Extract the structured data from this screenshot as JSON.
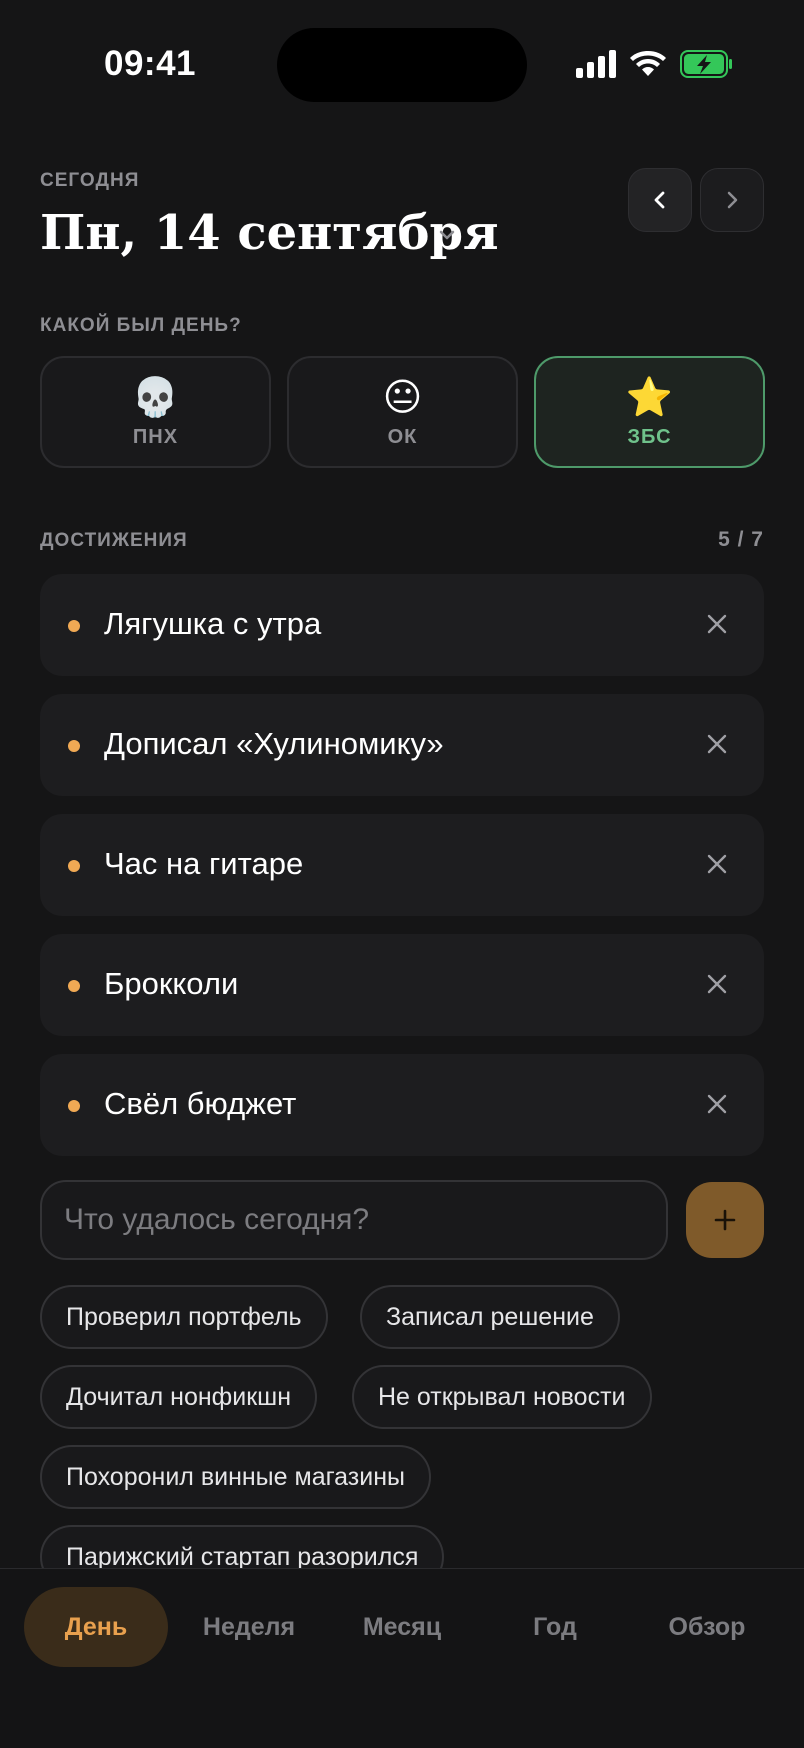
{
  "status_bar": {
    "time": "09:41"
  },
  "header": {
    "today_label": "СЕГОДНЯ",
    "date": "Пн, 14 сентября"
  },
  "mood": {
    "label": "КАКОЙ БЫЛ ДЕНЬ?",
    "options": [
      {
        "emoji": "💀",
        "label": "ПНХ",
        "selected": false
      },
      {
        "emoji": "😐",
        "label": "ОК",
        "selected": false
      },
      {
        "emoji": "⭐",
        "label": "ЗБС",
        "selected": true
      }
    ]
  },
  "achievements": {
    "label": "ДОСТИЖЕНИЯ",
    "count": "5 / 7",
    "items": [
      "Лягушка с утра",
      "Дописал «Хулиномику»",
      "Час на гитаре",
      "Брокколи",
      "Свёл бюджет"
    ]
  },
  "add": {
    "placeholder": "Что удалось сегодня?"
  },
  "suggestions": [
    "Проверил портфель",
    "Записал решение",
    "Дочитал нонфикшн",
    "Не открывал новости",
    "Похоронил винные магазины",
    "Парижский стартап разорился"
  ],
  "tabs": [
    {
      "label": "День",
      "active": true
    },
    {
      "label": "Неделя",
      "active": false
    },
    {
      "label": "Месяц",
      "active": false
    },
    {
      "label": "Год",
      "active": false
    },
    {
      "label": "Обзор",
      "active": false
    }
  ],
  "colors": {
    "background": "#151516",
    "accent": "#f0a954",
    "selected_green": "#6fc28b"
  }
}
